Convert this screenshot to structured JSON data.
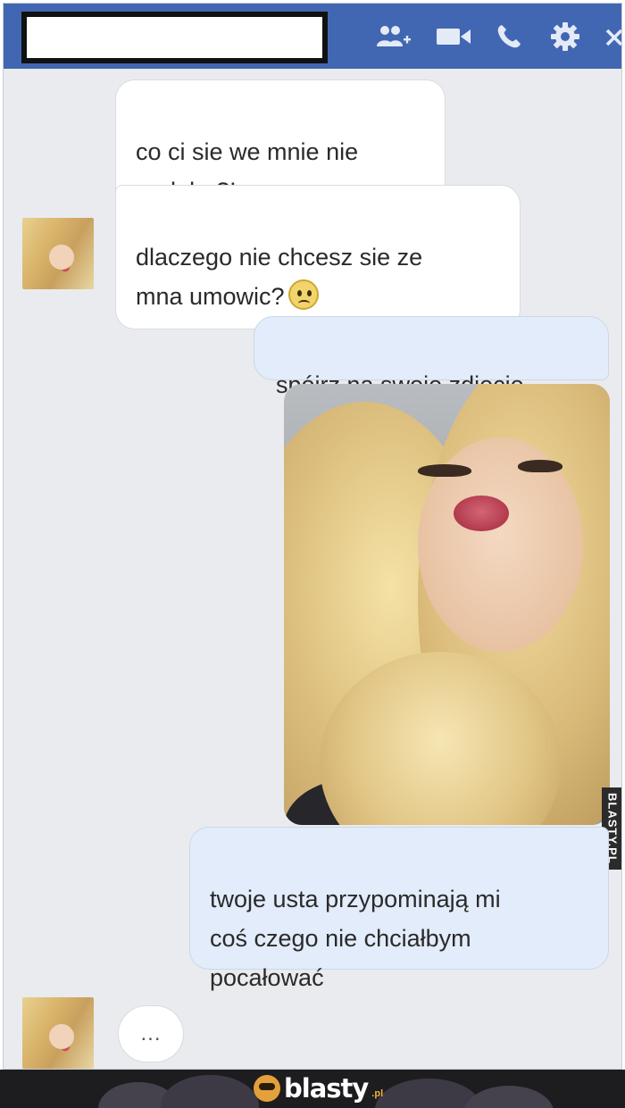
{
  "header": {
    "icons": [
      "add-person-icon",
      "video-camera-icon",
      "phone-icon",
      "gear-icon",
      "close-icon"
    ]
  },
  "messages": [
    {
      "side": "incoming",
      "text": "co ci sie we mnie nie\npodoba?!"
    },
    {
      "side": "incoming",
      "text": "dlaczego nie chcesz sie ze\nmna umowic?",
      "emoji": "frowning-face"
    },
    {
      "side": "outgoing",
      "text": "spójrz na swoje zdjęcie"
    },
    {
      "side": "outgoing",
      "type": "photo"
    },
    {
      "side": "outgoing",
      "text": "twoje usta przypominają mi\ncoś czego nie chciałbym\npocałować"
    }
  ],
  "typing_indicator": "...",
  "watermark": "BLASTY.PL",
  "footer": {
    "logo_text": "blasty",
    "logo_suffix": ".pl"
  },
  "colors": {
    "header": "#4267b2",
    "chat_background": "#e9ebee",
    "incoming_bubble": "#ffffff",
    "outgoing_bubble": "#e2ecfa",
    "footer": "#1d1d1f"
  }
}
